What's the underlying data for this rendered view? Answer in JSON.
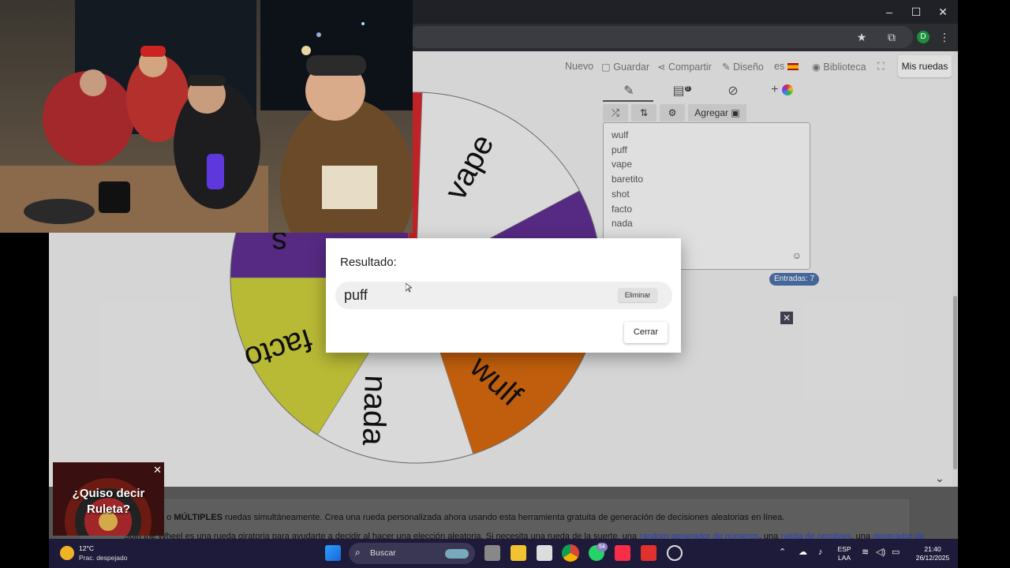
{
  "browser": {
    "window_controls": [
      "–",
      "☐",
      "✕"
    ],
    "profile_initial": "D"
  },
  "menu": {
    "nuevo": "Nuevo",
    "guardar": "Guardar",
    "compartir": "Compartir",
    "diseno": "Diseño",
    "language": "es",
    "biblioteca": "Biblioteca",
    "mis_ruedas": "Mis ruedas"
  },
  "tabs": {
    "badge": "0",
    "add_symbol": "+"
  },
  "toolbar": {
    "agregar": "Agregar"
  },
  "entries": [
    "wulf",
    "puff",
    "vape",
    "baretito",
    "shot",
    "facto",
    "nada"
  ],
  "entries_count": "Entradas: 7",
  "wheel": {
    "labels": [
      "vape",
      "facto",
      "nada",
      "wulf",
      "s"
    ],
    "colors": {
      "red": "#d1262b",
      "purple": "#5e2d8f",
      "yellow": "#c8c93a",
      "orange": "#d1660f",
      "white": "#ececec"
    }
  },
  "modal": {
    "title": "Resultado:",
    "result": "puff",
    "eliminar": "Eliminar",
    "cerrar": "Cerrar"
  },
  "below": {
    "line1_bold": "MÚLTIPLES",
    "line1_prefix": "a o",
    "line1_suffix": "ruedas simultáneamente. Crea una rueda personalizada ahora usando esta herramienta gratuita de generación de decisiones aleatorias en línea.",
    "line2_prefix": "Spin the Wheel es una rueda giratoria para ayudarte a decidir al hacer una elección aleatoria. Si necesita una rueda de la suerte, una",
    "link1": "random generador de números",
    "line2_mid": ", una",
    "link2": "rueda de nombres",
    "line2_end": ", una",
    "link3": "generador de"
  },
  "ad": {
    "text_line1": "¿Quiso decir",
    "text_line2": "Ruleta?",
    "close": "✕"
  },
  "taskbar": {
    "temperature": "12°C",
    "weather": "Prac. despejado",
    "search": "Buscar",
    "whatsapp_badge": "54",
    "lang1": "ESP",
    "lang2": "LAA",
    "time": "21:40",
    "date": "26/12/2025"
  }
}
